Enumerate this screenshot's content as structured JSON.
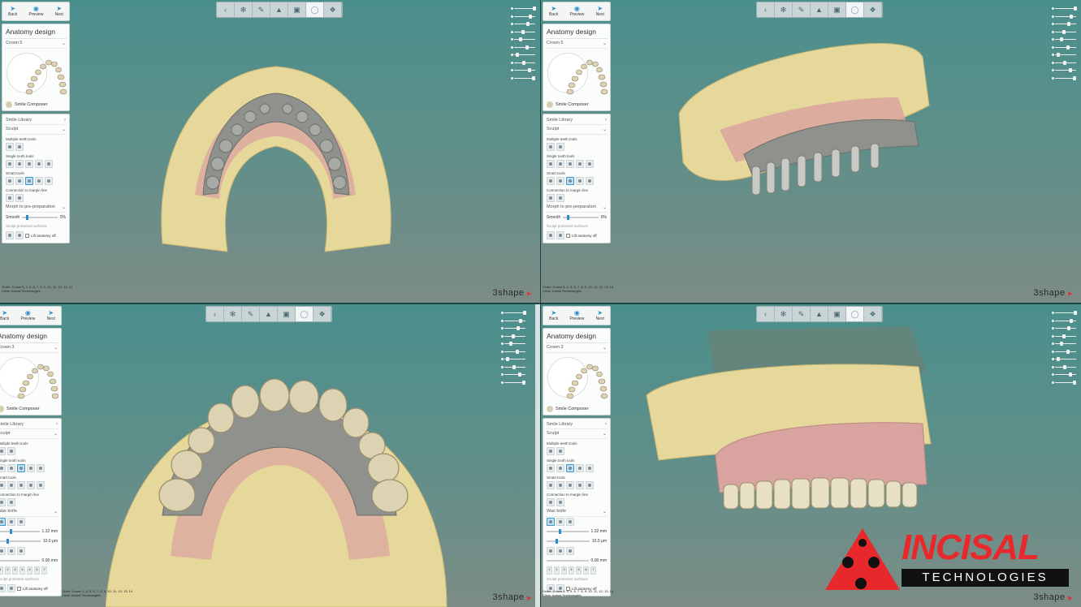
{
  "nav": {
    "back": "Back",
    "preview": "Preview",
    "next": "Next"
  },
  "panel": {
    "title": "Anatomy design",
    "smile_composer": "Smile Composer",
    "smile_library": "Smile Library",
    "sculpt": "Sculpt",
    "multiple_tools": "Multiple teeth tools",
    "single_tools": "Single tooth tools",
    "smart_tools": "Smart tools",
    "connection": "Connection to margin line",
    "morph": "Morph to pre-preparation",
    "wax_knife": "Wax knife",
    "smooth": "Smooth",
    "smooth_value": "0%",
    "sculpt_protected": "Sculpt protected surfaces",
    "lift_off": "Lift anatomy off",
    "wax_size": "1.32 mm",
    "wax_depth": "10.0 μm",
    "wax_offset": "0.00 mm",
    "wax_numbers": [
      "1",
      "2",
      "3",
      "4",
      "5",
      "6",
      "7"
    ]
  },
  "quadrants": [
    {
      "crown": "Crown 5",
      "mode": "morph"
    },
    {
      "crown": "Crown 5",
      "mode": "morph"
    },
    {
      "crown": "Crown 3",
      "mode": "wax"
    },
    {
      "crown": "Crown 3",
      "mode": "wax"
    }
  ],
  "footer": {
    "order_label": "Order:",
    "order_value": "Crown 3, 4, 5, 6, 7, 8, 9, 10, 11, 12, 13, 14",
    "clinic_label": "Clinic:",
    "clinic_value": "Incisal Technologies"
  },
  "brand": "3shape",
  "logo": {
    "word": "INCISAL",
    "sub": "TECHNOLOGIES"
  },
  "colors": {
    "accent": "#2b8fc7",
    "logo_red": "#e8282b",
    "stone": "#e6d79a",
    "gum": "#d9a3a0",
    "metal": "#8f918c"
  }
}
